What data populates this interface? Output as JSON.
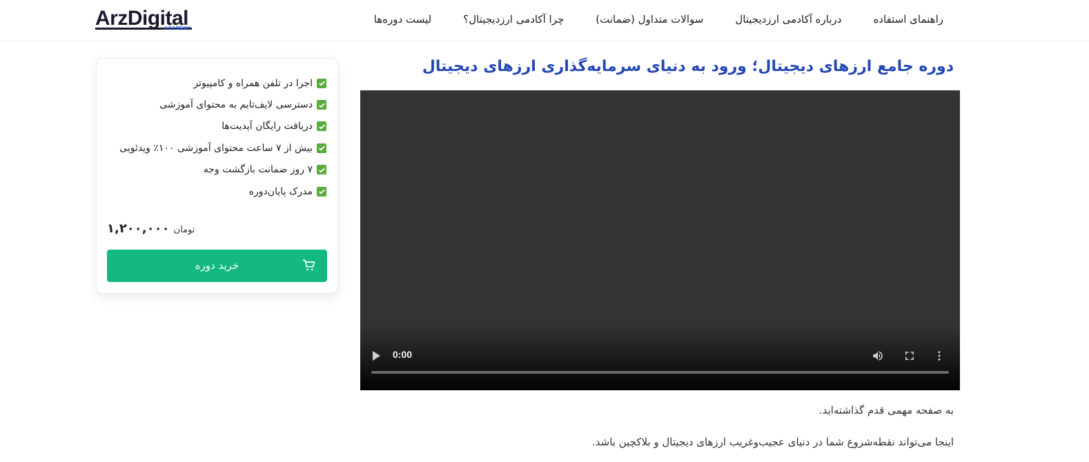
{
  "header": {
    "logo": {
      "text": "ArzDigital",
      "sub": "ACADEMY"
    },
    "nav": [
      {
        "label": "لیست دوره‌ها"
      },
      {
        "label": "چرا آکادمی ارزدیجیتال؟"
      },
      {
        "label": "سوالات متداول (ضمانت)"
      },
      {
        "label": "درباره آکادمی ارزدیجیتال"
      },
      {
        "label": "راهنمای استفاده"
      }
    ]
  },
  "main": {
    "title": "دوره جامع ارزهای دیجیتال؛ ورود به دنیای سرمایه‌گذاری ارزهای دیجیتال",
    "video": {
      "time": "0:00",
      "progress": 0
    },
    "paragraphs": [
      "به صفحه مهمی قدم گذاشته‌اید.",
      "اینجا می‌تواند نقطه‌شروع شما در دنیای عجیب‌وغریب ارزهای دیجیتال و بلاکچین باشد."
    ]
  },
  "sidebar": {
    "features": [
      {
        "icon": "check-icon",
        "text": "اجرا در تلفن همراه و کامپیوتر"
      },
      {
        "icon": "check-icon",
        "text": "دسترسی لایف‌تایم به محتوای آموزشی"
      },
      {
        "icon": "check-icon",
        "text": "دریافت رایگان آپدیت‌ها"
      },
      {
        "icon": "check-icon",
        "text": "بیش از ۷ ساعت محتوای آموزشی ۱۰۰٪ ویدئویی"
      },
      {
        "icon": "check-icon",
        "text": "۷ روز ضمانت بازگشت وجه"
      },
      {
        "icon": "check-icon",
        "text": "مدرک پایان‌دوره"
      }
    ],
    "price": {
      "amount": "۱,۲۰۰,۰۰۰",
      "currency": "تومان"
    },
    "buy_label": "خرید دوره"
  },
  "colors": {
    "title": "#2347b5",
    "buy_button": "#14b883",
    "check": "#5aaa3c",
    "video_bg": "#333333"
  }
}
